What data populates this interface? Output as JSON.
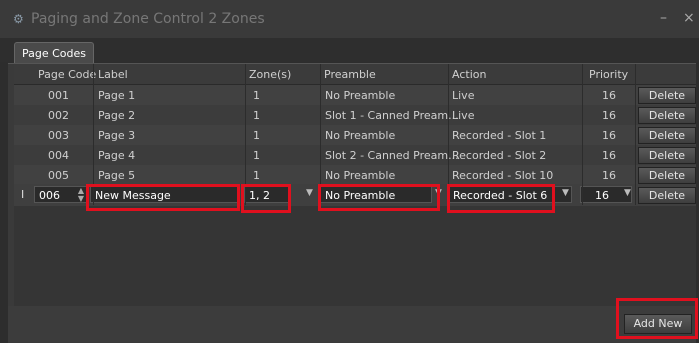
{
  "window": {
    "title": "Paging and Zone Control 2 Zones",
    "icon": "gear-icon",
    "minimize": "–",
    "close": "×"
  },
  "tabs": [
    {
      "label": "Page Codes"
    }
  ],
  "table": {
    "columns": [
      "Page Code",
      "Label",
      "Zone(s)",
      "Preamble",
      "Action",
      "Priority"
    ],
    "rows": [
      {
        "code": "001",
        "label": "Page 1",
        "zones": "1",
        "preamble": "No Preamble",
        "action": "Live",
        "priority": "16",
        "delete": "Delete"
      },
      {
        "code": "002",
        "label": "Page 2",
        "zones": "1",
        "preamble": "Slot 1 - Canned Pream...",
        "action": "Live",
        "priority": "16",
        "delete": "Delete"
      },
      {
        "code": "003",
        "label": "Page 3",
        "zones": "1",
        "preamble": "No Preamble",
        "action": "Recorded - Slot 1",
        "priority": "16",
        "delete": "Delete"
      },
      {
        "code": "004",
        "label": "Page 4",
        "zones": "1",
        "preamble": "Slot 2 - Canned Pream...",
        "action": "Recorded - Slot 2",
        "priority": "16",
        "delete": "Delete"
      },
      {
        "code": "005",
        "label": "Page 5",
        "zones": "1",
        "preamble": "No Preamble",
        "action": "Recorded - Slot 10",
        "priority": "16",
        "delete": "Delete"
      }
    ],
    "edit_row": {
      "cursor": "I",
      "code": "006",
      "label": "New Message",
      "zones": "1, 2",
      "preamble": "No Preamble",
      "action": "Recorded - Slot 6",
      "priority": "16",
      "delete": "Delete"
    }
  },
  "footer": {
    "add_new": "Add New"
  },
  "colors": {
    "highlight": "#e0101e"
  }
}
